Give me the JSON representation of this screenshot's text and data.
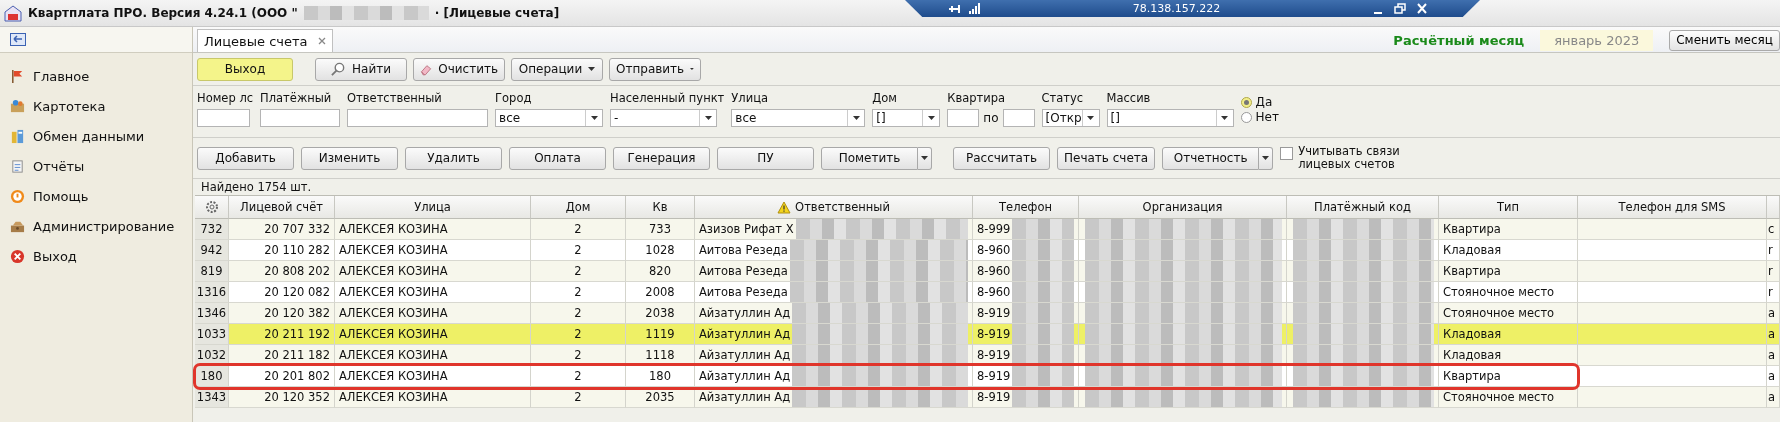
{
  "window": {
    "title_start": "Квартплата ПРО.  Версия 4.24.1 (ООО \"",
    "title_end": "· [Лицевые счета]"
  },
  "remote_bar": {
    "address": "78.138.157.222"
  },
  "sidebar": {
    "items": [
      {
        "label": "Главное",
        "kind": "flag"
      },
      {
        "label": "Картотека",
        "kind": "cards"
      },
      {
        "label": "Обмен данными",
        "kind": "exchange"
      },
      {
        "label": "Отчёты",
        "kind": "reports"
      },
      {
        "label": "Помощь",
        "kind": "help"
      },
      {
        "label": "Администрирование",
        "kind": "admin"
      },
      {
        "label": "Выход",
        "kind": "exit"
      }
    ]
  },
  "tabs": [
    {
      "label": "Лицевые счета",
      "selected": true
    }
  ],
  "period": {
    "label": "Расчётный месяц",
    "value": "январь 2023",
    "button": "Сменить месяц"
  },
  "toolbar": [
    {
      "label": "Выход",
      "kind": "primary"
    },
    {
      "label": "Найти",
      "kind": "search"
    },
    {
      "label": "Очистить",
      "kind": "eraser"
    },
    {
      "label": "Операции",
      "kind": "menu"
    },
    {
      "label": "Отправить",
      "kind": "menu"
    }
  ],
  "filters": [
    {
      "label": "Номер лс",
      "kind": "text"
    },
    {
      "label": "Платёжный",
      "kind": "text"
    },
    {
      "label": "Ответственный",
      "kind": "text"
    },
    {
      "label": "Город",
      "kind": "combo",
      "value": "все"
    },
    {
      "label": "Населенный пункт",
      "kind": "combo",
      "value": "-"
    },
    {
      "label": "Улица",
      "kind": "combo",
      "value": "все"
    },
    {
      "label": "Дом",
      "kind": "combo",
      "value": "[]"
    },
    {
      "label": "Квартира",
      "kind": "range",
      "between": "по"
    },
    {
      "label": "Статус",
      "kind": "combo",
      "value": "[Откр"
    },
    {
      "label": "Массив",
      "kind": "combo",
      "value": "[]"
    }
  ],
  "radios": [
    {
      "label": "Да",
      "selected": true
    },
    {
      "label": "Нет",
      "selected": false
    }
  ],
  "actions": [
    {
      "label": "Добавить",
      "kind": "plain"
    },
    {
      "label": "Изменить",
      "kind": "plain"
    },
    {
      "label": "Удалить",
      "kind": "plain"
    },
    {
      "label": "Оплата",
      "kind": "plain"
    },
    {
      "label": "Генерация",
      "kind": "plain"
    },
    {
      "label": "ПУ",
      "kind": "plain"
    },
    {
      "label": "Пометить",
      "kind": "split"
    },
    {
      "label": "Рассчитать",
      "kind": "plain"
    },
    {
      "label": "Печать счета",
      "kind": "plain"
    },
    {
      "label": "Отчетность",
      "kind": "split"
    }
  ],
  "link_option": {
    "label": "Учитывать связи лицевых счетов",
    "checked": false
  },
  "found": "Найдено 1754 шт.",
  "table": {
    "columns": [
      {
        "label": "Лицевой счёт",
        "warning": false
      },
      {
        "label": "Улица",
        "warning": false
      },
      {
        "label": "Дом",
        "warning": false
      },
      {
        "label": "Кв",
        "warning": false
      },
      {
        "label": "Ответственный",
        "warning": true
      },
      {
        "label": "Телефон",
        "warning": false
      },
      {
        "label": "Организация",
        "warning": false
      },
      {
        "label": "Платёжный код",
        "warning": false
      },
      {
        "label": "Тип",
        "warning": false
      },
      {
        "label": "Телефон для SMS",
        "warning": false
      }
    ],
    "rows": [
      {
        "n": "732",
        "account": "20 707 332",
        "street": "АЛЕКСЕЯ КОЗИНА",
        "house": "2",
        "flat": "733",
        "responsible": "Азизов Рифат Х",
        "phone": "8-999",
        "type": "Квартира",
        "column_12": "c",
        "selected": false,
        "outlined": false
      },
      {
        "n": "942",
        "account": "20 110 282",
        "street": "АЛЕКСЕЯ КОЗИНА",
        "house": "2",
        "flat": "1028",
        "responsible": "Аитова Резеда",
        "phone": "8-960",
        "type": "Кладовая",
        "column_12": "r",
        "selected": false,
        "outlined": false
      },
      {
        "n": "819",
        "account": "20 808 202",
        "street": "АЛЕКСЕЯ КОЗИНА",
        "house": "2",
        "flat": "820",
        "responsible": "Аитова Резеда",
        "phone": "8-960",
        "type": "Квартира",
        "column_12": "r",
        "selected": false,
        "outlined": false
      },
      {
        "n": "1316",
        "account": "20 120 082",
        "street": "АЛЕКСЕЯ КОЗИНА",
        "house": "2",
        "flat": "2008",
        "responsible": "Аитова Резеда",
        "phone": "8-960",
        "type": "Стояночное место",
        "column_12": "r",
        "selected": false,
        "outlined": false
      },
      {
        "n": "1346",
        "account": "20 120 382",
        "street": "АЛЕКСЕЯ КОЗИНА",
        "house": "2",
        "flat": "2038",
        "responsible": "Айзатуллин Ад",
        "phone": "8-919",
        "type": "Стояночное место",
        "column_12": "a",
        "selected": false,
        "outlined": false
      },
      {
        "n": "1033",
        "account": "20 211 192",
        "street": "АЛЕКСЕЯ КОЗИНА",
        "house": "2",
        "flat": "1119",
        "responsible": "Айзатуллин Ад",
        "phone": "8-919",
        "type": "Кладовая",
        "column_12": "a",
        "selected": true,
        "outlined": false
      },
      {
        "n": "1032",
        "account": "20 211 182",
        "street": "АЛЕКСЕЯ КОЗИНА",
        "house": "2",
        "flat": "1118",
        "responsible": "Айзатуллин Ад",
        "phone": "8-919",
        "type": "Кладовая",
        "column_12": "a",
        "selected": false,
        "outlined": false
      },
      {
        "n": "180",
        "account": "20 201 802",
        "street": "АЛЕКСЕЯ КОЗИНА",
        "house": "2",
        "flat": "180",
        "responsible": "Айзатуллин Ад",
        "phone": "8-919",
        "type": "Квартира",
        "column_12": "a",
        "selected": false,
        "outlined": true
      },
      {
        "n": "1343",
        "account": "20 120 352",
        "street": "АЛЕКСЕЯ КОЗИНА",
        "house": "2",
        "flat": "2035",
        "responsible": "Айзатуллин Ад",
        "phone": "8-919",
        "type": "Стояночное место",
        "column_12": "a",
        "selected": false,
        "outlined": false
      }
    ]
  }
}
